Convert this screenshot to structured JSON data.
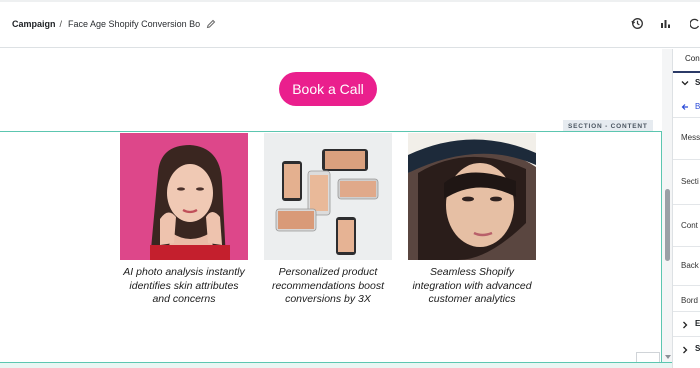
{
  "header": {
    "breadcrumb_root": "Campaign",
    "breadcrumb_separator": "/",
    "campaign_title": "Face Age Shopify Conversion Bo"
  },
  "canvas": {
    "cta_label": "Book a Call",
    "section_tag": "SECTION - CONTENT",
    "cards": [
      {
        "caption": "AI photo analysis instantly identifies skin attributes and concerns",
        "image": "woman-portrait-pink-background"
      },
      {
        "caption": "Personalized product recommendations boost conversions by 3X",
        "image": "phones-showing-face-photos"
      },
      {
        "caption": "Seamless Shopify integration with advanced customer analytics",
        "image": "woman-with-white-hat"
      }
    ]
  },
  "panel": {
    "tab_label": "Con",
    "section_label": "S",
    "back_label": "B",
    "items": [
      "Mess",
      "Secti",
      "Cont",
      "Back",
      "Bord"
    ],
    "collapsed_items": [
      "E",
      "S"
    ]
  },
  "colors": {
    "accent": "#ea1f8d",
    "section_outline": "#5cc6b0",
    "panel_accent": "#2b3a67",
    "link_blue": "#2b4bd8"
  },
  "icons": [
    "pencil-icon",
    "history-icon",
    "bar-chart-icon",
    "refresh-icon",
    "chevron-down-icon",
    "arrow-left-icon",
    "chevron-right-icon"
  ]
}
